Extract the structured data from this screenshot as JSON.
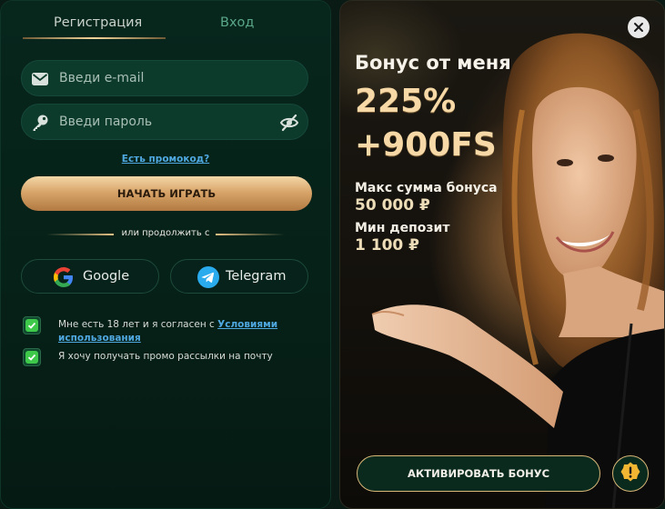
{
  "tabs": {
    "register": "Регистрация",
    "login": "Вход"
  },
  "form": {
    "email_placeholder": "Введи e-mail",
    "password_placeholder": "Введи пароль",
    "promo_link": "Есть промокод?",
    "play_button": "НАЧАТЬ ИГРАТЬ",
    "or_continue": "или продолжить с"
  },
  "social": {
    "google": "Google",
    "telegram": "Telegram"
  },
  "consents": {
    "age_text": "Мне есть 18 лет и я согласен с ",
    "age_link": "Условиями использования",
    "newsletter_text": "Я хочу получать промо рассылки на почту",
    "age_checked": true,
    "newsletter_checked": true
  },
  "bonus": {
    "title": "Бонус от меня",
    "percent": "225%",
    "freespins": "+900FS",
    "max_label": "Макс сумма бонуса",
    "max_value": "50 000 ₽",
    "min_label": "Мин депозит",
    "min_value": "1 100 ₽",
    "activate_button": "АКТИВИРОВАТЬ БОНУС"
  },
  "icons": {
    "email": "mail-icon",
    "password": "key-icon",
    "visibility": "eye-off-icon",
    "google": "google-icon",
    "telegram": "telegram-icon",
    "close": "close-icon",
    "warning": "warning-icon"
  },
  "colors": {
    "accent_gold": "#e7c184",
    "link_blue": "#4fa8e0",
    "check_green": "#3ec94a",
    "panel_green": "#062118"
  }
}
